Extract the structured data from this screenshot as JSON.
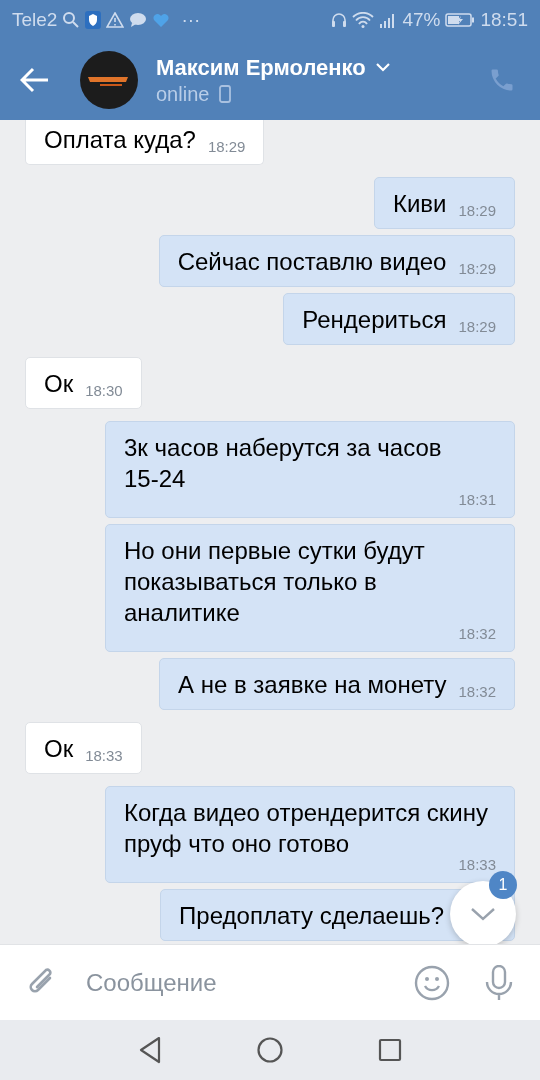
{
  "status_bar": {
    "carrier": "Tele2",
    "more": "···",
    "battery_percent": "47%",
    "time": "18:51"
  },
  "header": {
    "name": "Максим Ермоленко",
    "status": "online"
  },
  "messages": [
    {
      "text": "Оплата куда?",
      "time": "18:29",
      "outgoing": false
    },
    {
      "text": "Киви",
      "time": "18:29",
      "outgoing": true
    },
    {
      "text": "Сейчас поставлю видео",
      "time": "18:29",
      "outgoing": true
    },
    {
      "text": "Рендериться",
      "time": "18:29",
      "outgoing": true
    },
    {
      "text": "Ок",
      "time": "18:30",
      "outgoing": false
    },
    {
      "text": "3к часов наберутся за часов 15-24",
      "time": "18:31",
      "outgoing": true
    },
    {
      "text": "Но они первые сутки будут показываться только в аналитике",
      "time": "18:32",
      "outgoing": true
    },
    {
      "text": "А не в заявке на монету",
      "time": "18:32",
      "outgoing": true
    },
    {
      "text": "Ок",
      "time": "18:33",
      "outgoing": false
    },
    {
      "text": "Когда видео отрендерится скину пруф что оно готово",
      "time": "18:33",
      "outgoing": true
    },
    {
      "text": "Предоплату сделаешь?",
      "outgoing": true
    }
  ],
  "scroll_button": {
    "badge": "1"
  },
  "composer": {
    "placeholder": "Сообщение"
  }
}
